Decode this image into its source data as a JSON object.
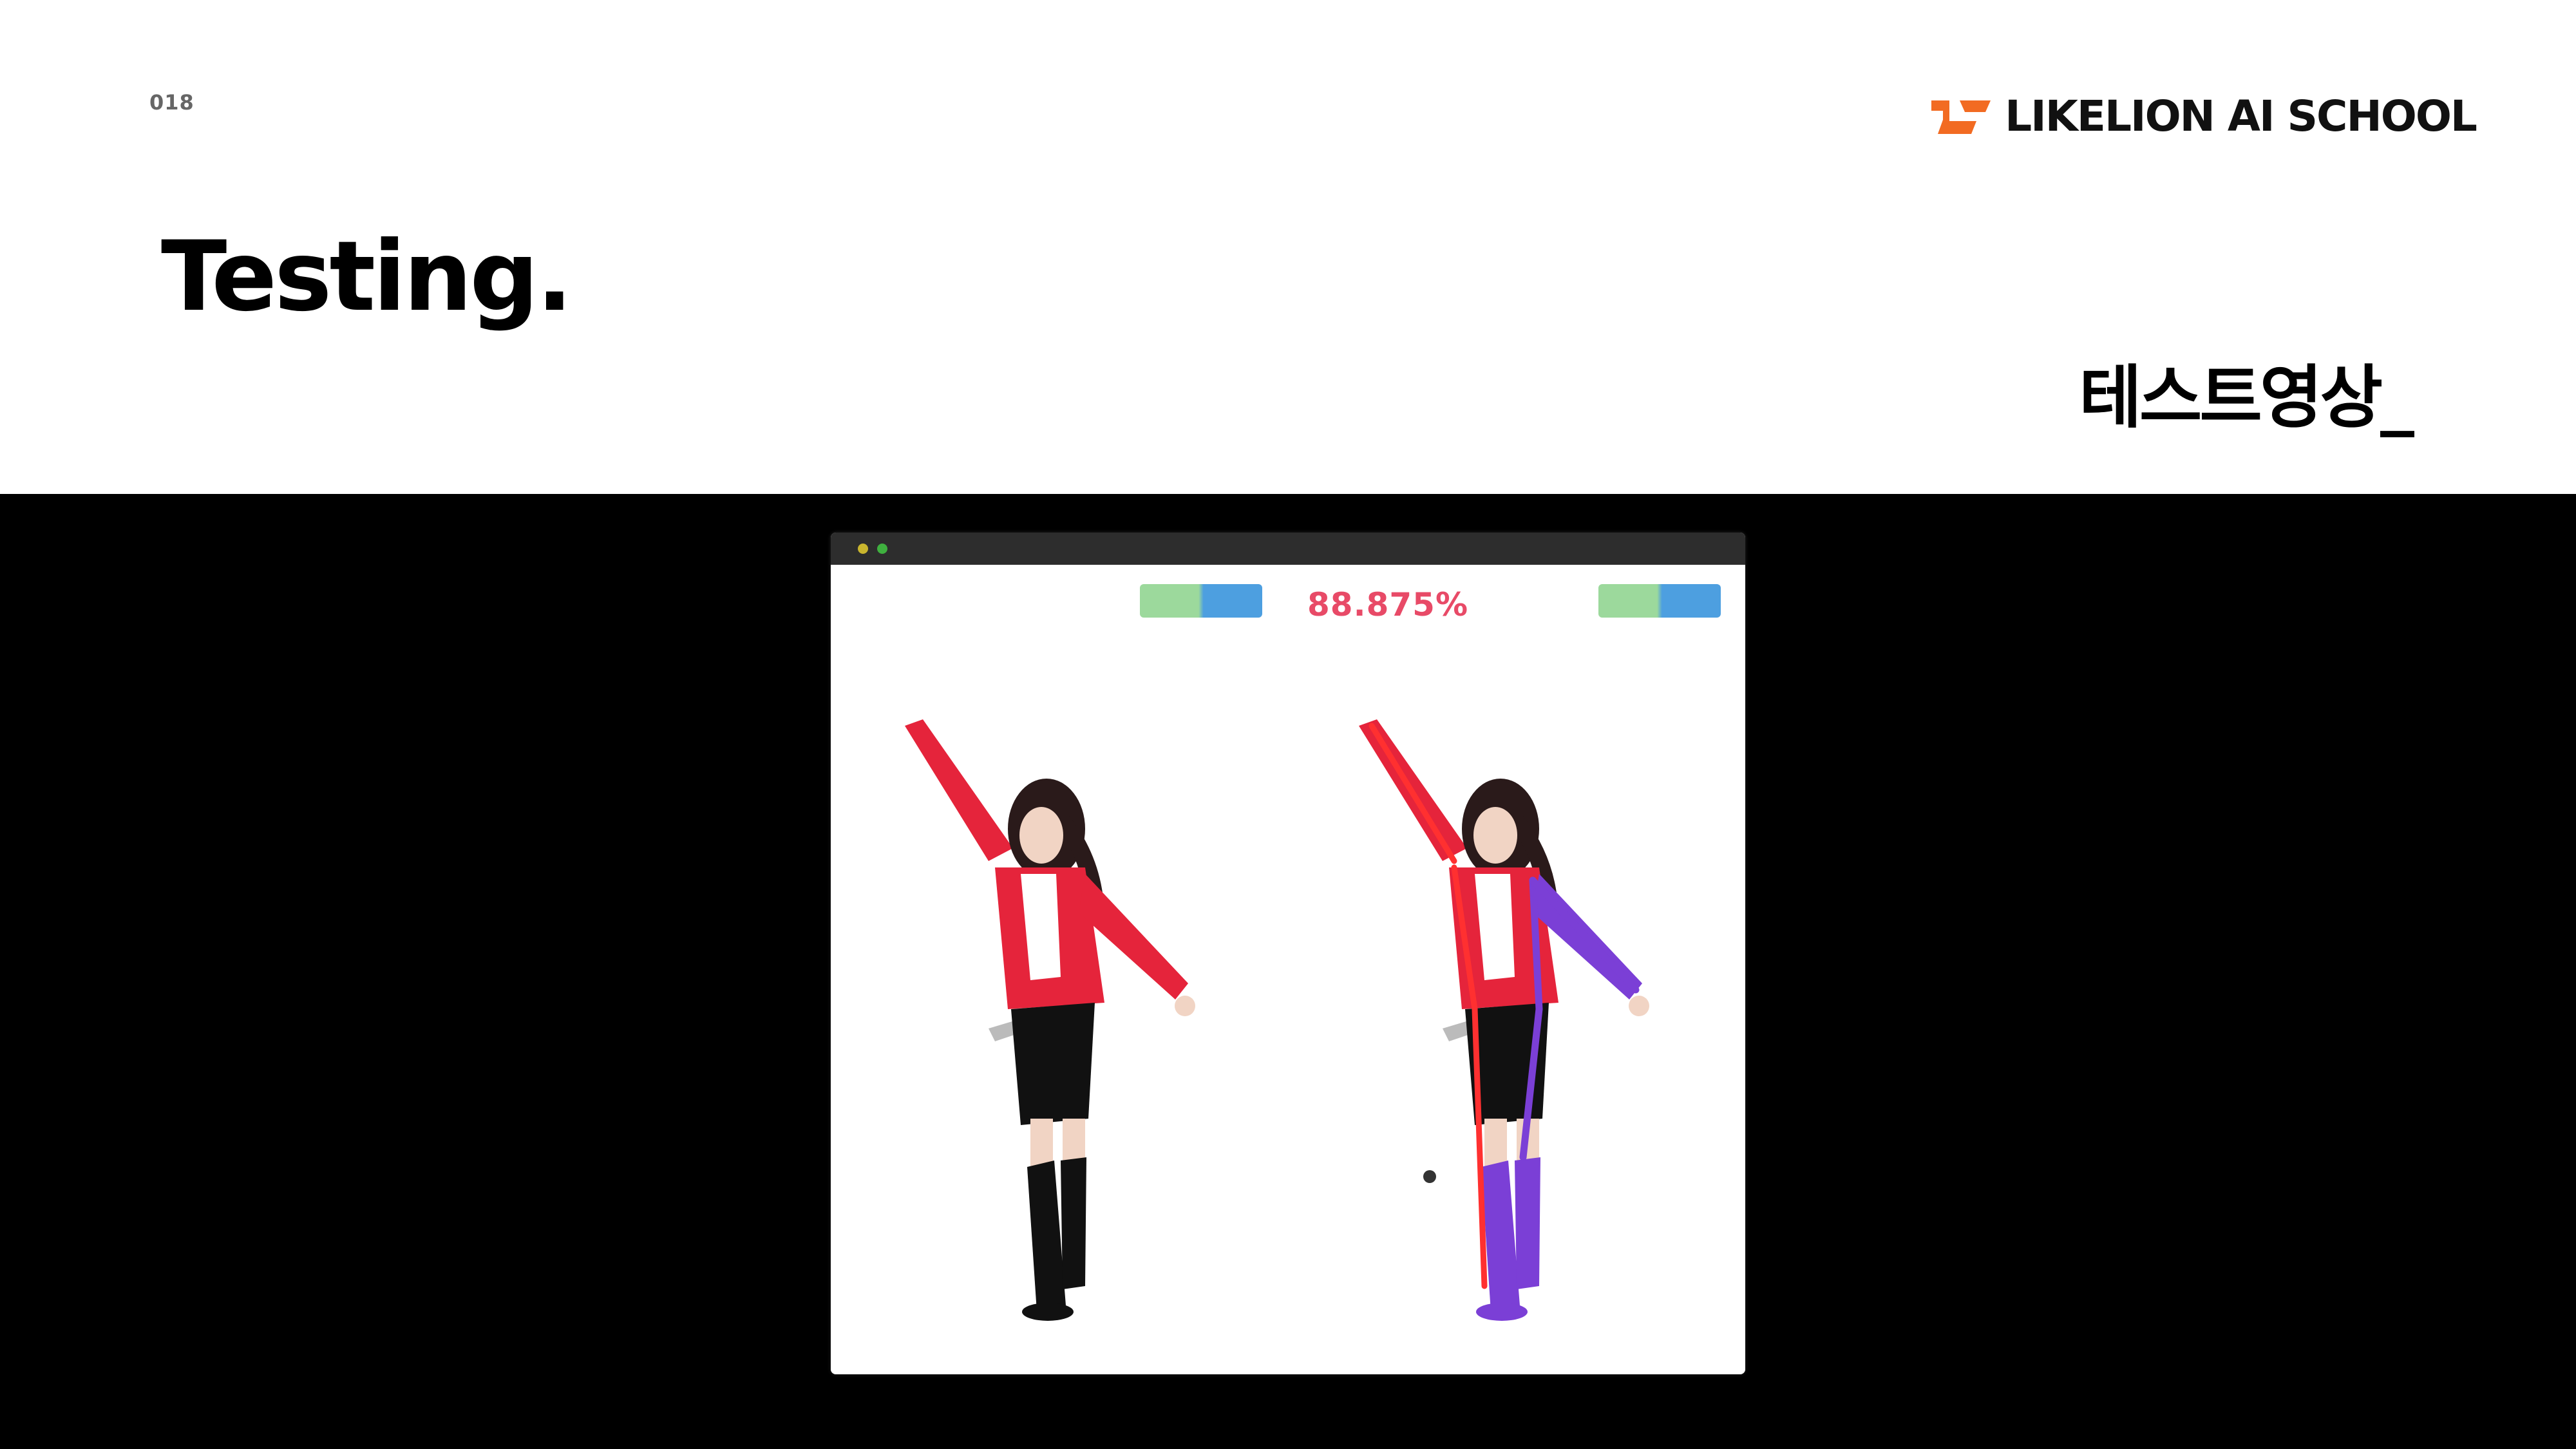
{
  "page_number": "018",
  "brand": {
    "name": "LIKELION AI SCHOOL",
    "logo_color": "#f26b22"
  },
  "title": "Testing.",
  "subtitle": "테스트영상_",
  "video": {
    "window_title": "",
    "left_tag": "",
    "right_tag": "",
    "score": "88.875%",
    "colors": {
      "jacket": "#e5243b",
      "skeleton": "#7b3fd6",
      "score": "#e84a67"
    }
  }
}
